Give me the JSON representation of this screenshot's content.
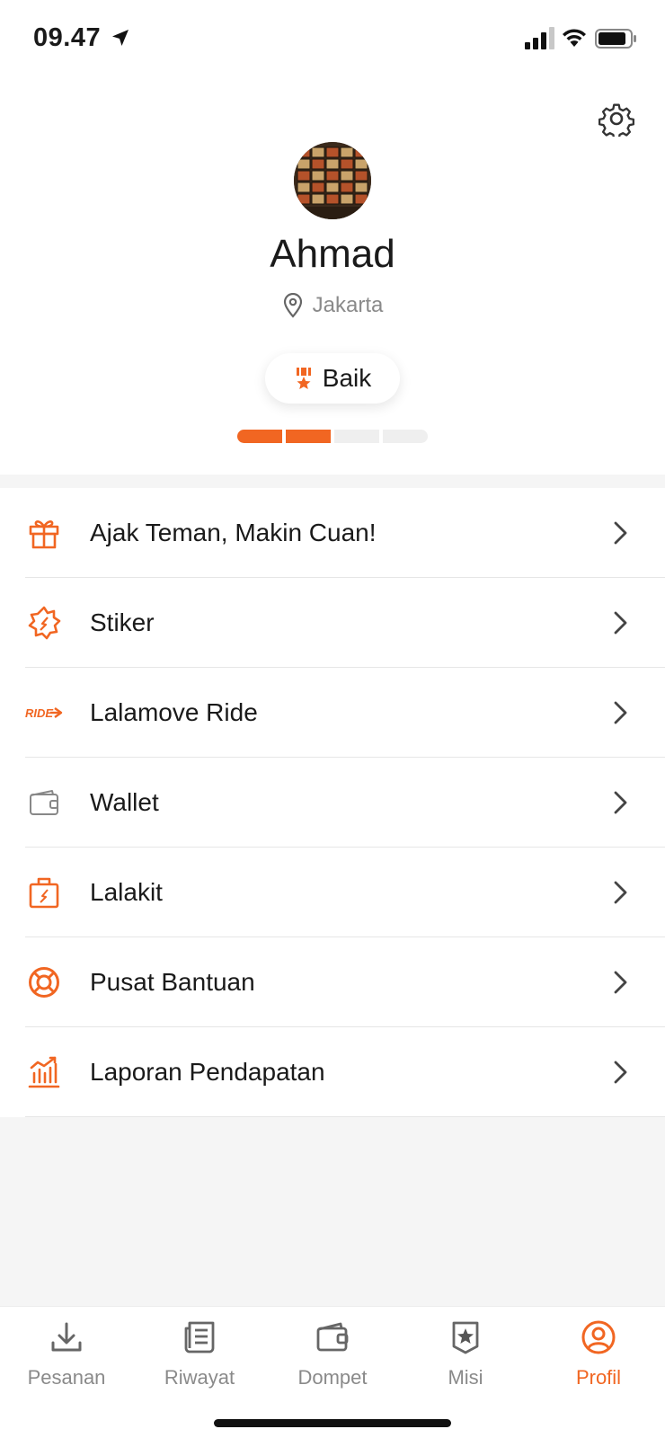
{
  "status_bar": {
    "time": "09.47"
  },
  "profile": {
    "name": "Ahmad",
    "location": "Jakarta",
    "rating_label": "Baik",
    "rating_level": {
      "filled": 2,
      "total": 4
    }
  },
  "menu": {
    "items": [
      {
        "label": "Ajak Teman, Makin Cuan!",
        "icon": "gift-icon"
      },
      {
        "label": "Stiker",
        "icon": "sticker-icon"
      },
      {
        "label": "Lalamove Ride",
        "icon": "ride-icon"
      },
      {
        "label": "Wallet",
        "icon": "wallet-icon"
      },
      {
        "label": "Lalakit",
        "icon": "lalakit-bag-icon"
      },
      {
        "label": "Pusat Bantuan",
        "icon": "lifebuoy-icon"
      },
      {
        "label": "Laporan Pendapatan",
        "icon": "chart-icon"
      }
    ],
    "ride_icon_text": "RIDE"
  },
  "tabs": [
    {
      "label": "Pesanan",
      "icon": "download-icon"
    },
    {
      "label": "Riwayat",
      "icon": "history-icon"
    },
    {
      "label": "Dompet",
      "icon": "wallet-icon"
    },
    {
      "label": "Misi",
      "icon": "mission-star-icon"
    },
    {
      "label": "Profil",
      "icon": "profile-icon",
      "active": true
    }
  ],
  "colors": {
    "accent": "#f16622",
    "text": "#1a1a1a",
    "muted": "#8a8a8a"
  }
}
